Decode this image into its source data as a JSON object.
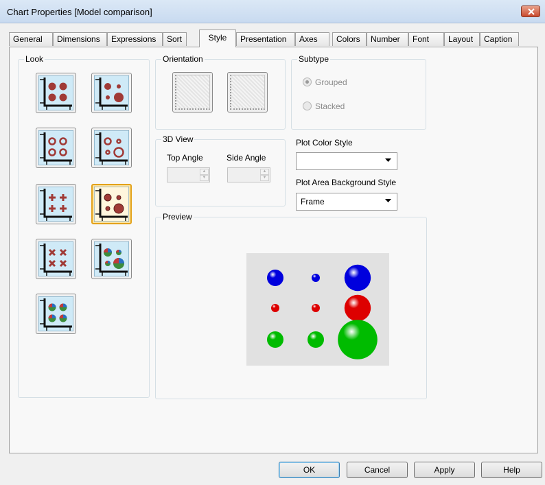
{
  "window": {
    "title": "Chart Properties [Model comparison]"
  },
  "tabs": [
    {
      "label": "General"
    },
    {
      "label": "Dimensions"
    },
    {
      "label": "Expressions"
    },
    {
      "label": "Sort"
    },
    {
      "label": "Style",
      "active": true
    },
    {
      "label": "Presentation"
    },
    {
      "label": "Axes"
    },
    {
      "label": "Colors"
    },
    {
      "label": "Number"
    },
    {
      "label": "Font"
    },
    {
      "label": "Layout"
    },
    {
      "label": "Caption"
    }
  ],
  "look": {
    "label": "Look",
    "options": [
      {
        "icon": "filled-dots-grid-icon"
      },
      {
        "icon": "filled-bubbles-mixed-icon"
      },
      {
        "icon": "ring-dots-grid-icon"
      },
      {
        "icon": "ring-bubbles-mixed-icon"
      },
      {
        "icon": "cross-dots-grid-icon"
      },
      {
        "icon": "3d-bubbles-icon",
        "selected": true
      },
      {
        "icon": "x-marks-grid-icon"
      },
      {
        "icon": "pie-bubbles-mixed-icon"
      },
      {
        "icon": "pie-dots-grid-icon"
      }
    ]
  },
  "orientation": {
    "label": "Orientation"
  },
  "subtype": {
    "label": "Subtype",
    "grouped": "Grouped",
    "stacked": "Stacked",
    "selected": "Grouped",
    "disabled": true
  },
  "view3d": {
    "label": "3D View",
    "top_angle": "Top Angle",
    "side_angle": "Side Angle"
  },
  "plot_color_style": {
    "label": "Plot Color Style",
    "value": ""
  },
  "plot_area_bg": {
    "label": "Plot Area Background Style",
    "value": "Frame"
  },
  "preview": {
    "label": "Preview",
    "background": "#e1e1e1",
    "series_colors": [
      "#0000dd",
      "#dd0000",
      "#00bb00"
    ],
    "bubble_sizes": [
      [
        2,
        1,
        4
      ],
      [
        1,
        1,
        4
      ],
      [
        2,
        2,
        6
      ]
    ]
  },
  "buttons": {
    "ok": "OK",
    "cancel": "Cancel",
    "apply": "Apply",
    "help": "Help"
  },
  "colors": {
    "look_marker": "#a03a36",
    "selected_border": "#e3a21a",
    "icon_bg": "#cfeaf7"
  }
}
